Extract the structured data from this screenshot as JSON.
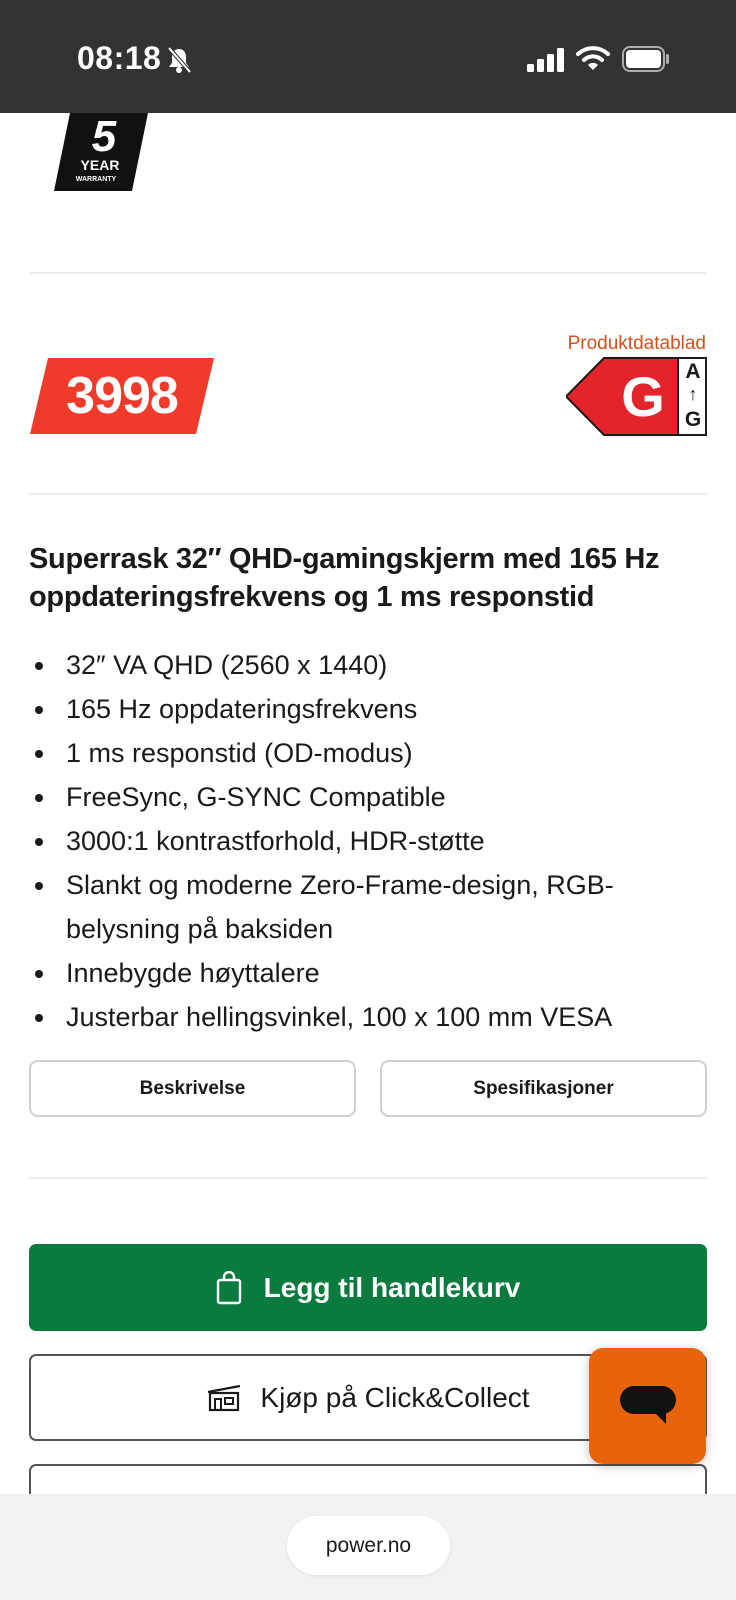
{
  "status_bar": {
    "time": "08:18",
    "icons": [
      "bell-muted-icon",
      "signal-icon",
      "wifi-icon",
      "battery-icon"
    ]
  },
  "warranty": {
    "number": "5",
    "line1": "YEAR",
    "line2": "WARRANTY"
  },
  "price": {
    "value": "3998",
    "color": "#f03a2a"
  },
  "energy": {
    "datasheet_link": "Produktdatablad",
    "class": "G",
    "scale_top": "A",
    "scale_bottom": "G",
    "color": "#e3242b"
  },
  "product": {
    "title": "Superrask 32″ QHD-gamingskjerm med 165 Hz oppdateringsfrekvens og 1 ms responstid",
    "features": [
      "32″ VA QHD (2560 x 1440)",
      "165 Hz oppdateringsfrekvens",
      "1 ms responstid (OD-modus)",
      "FreeSync, G-SYNC Compatible",
      "3000:1 kontrastforhold, HDR-støtte",
      "Slankt og moderne Zero-Frame-design, RGB-belysning på baksiden",
      "Innebygde høyttalere",
      "Justerbar hellingsvinkel, 100 x 100 mm VESA"
    ]
  },
  "tabs": {
    "description": "Beskrivelse",
    "specifications": "Spesifikasjoner"
  },
  "actions": {
    "add_to_cart": "Legg til handlekurv",
    "click_collect": "Kjøp på Click&Collect",
    "cart_color": "#0b7a3e",
    "chat_color": "#e8630a"
  },
  "browser": {
    "url": "power.no"
  }
}
